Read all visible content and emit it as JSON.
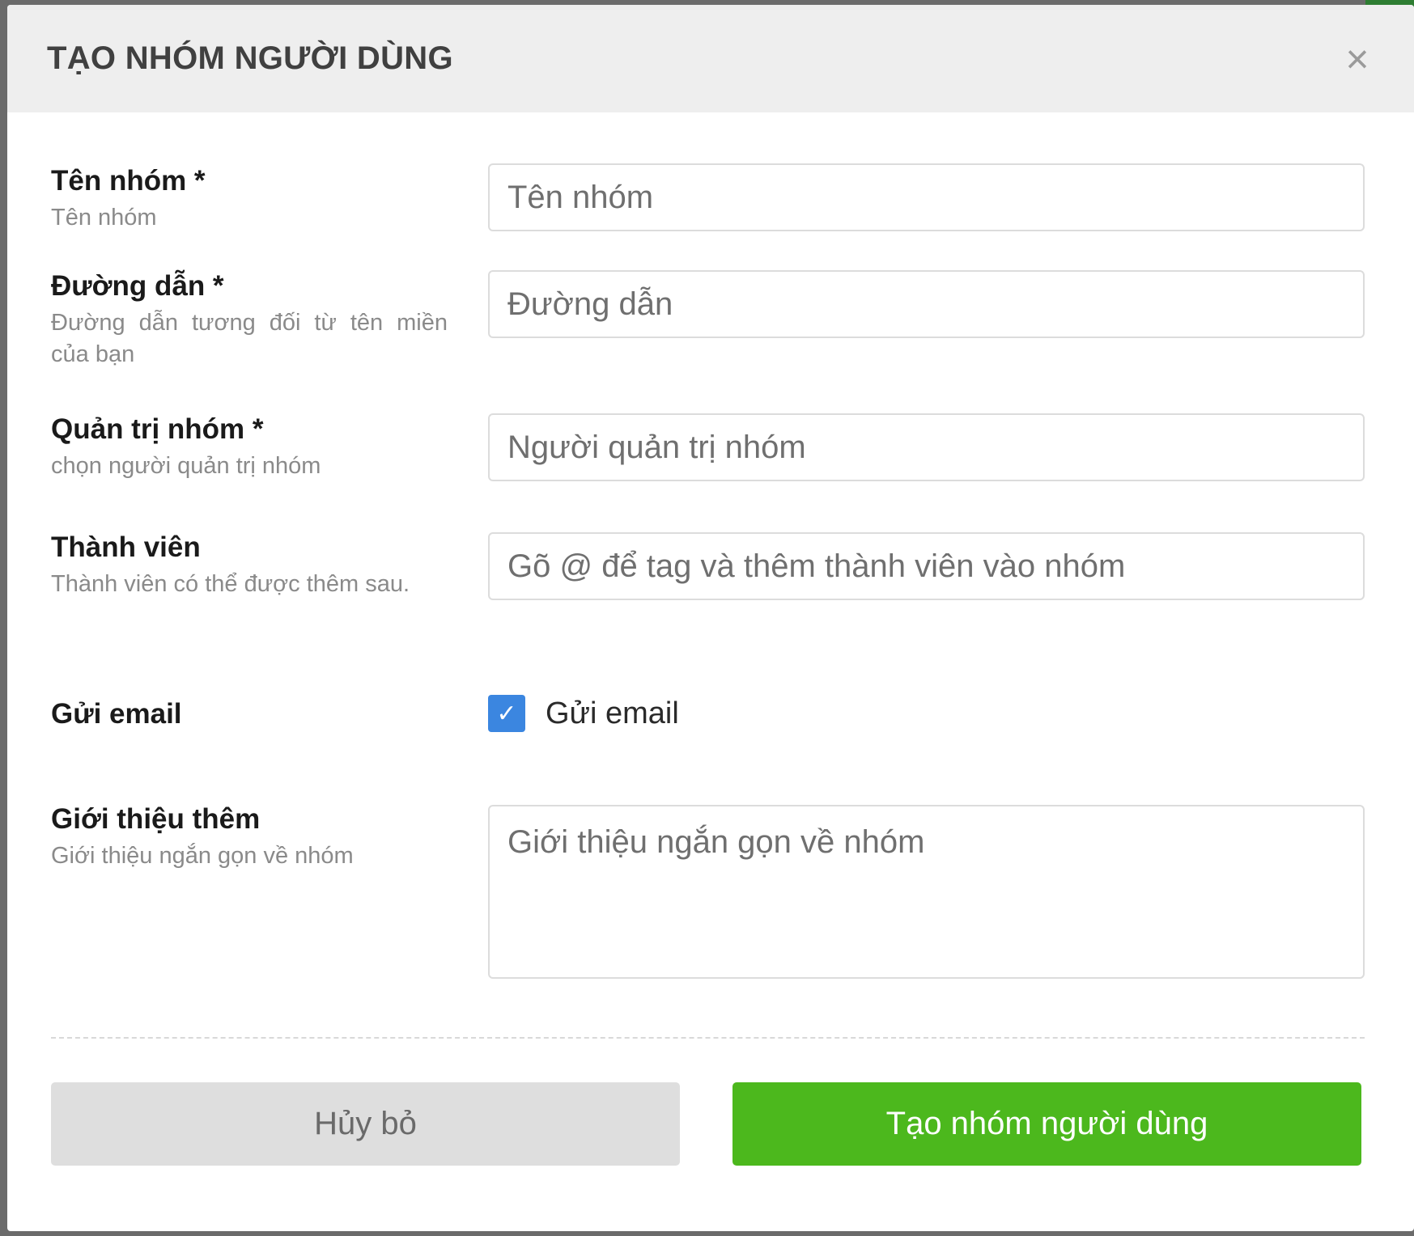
{
  "modal": {
    "title": "TẠO NHÓM NGƯỜI DÙNG",
    "close_icon": "×"
  },
  "fields": {
    "group_name": {
      "label": "Tên nhóm *",
      "help": "Tên nhóm",
      "placeholder": "Tên nhóm"
    },
    "path": {
      "label": "Đường dẫn *",
      "help": "Đường dẫn tương đối từ tên miền của bạn",
      "placeholder": "Đường dẫn"
    },
    "admin": {
      "label": "Quản trị nhóm *",
      "help": "chọn người quản trị nhóm",
      "placeholder": "Người quản trị nhóm"
    },
    "members": {
      "label": "Thành viên",
      "help": "Thành viên có thể được thêm sau.",
      "placeholder": "Gõ @ để tag và thêm thành viên vào nhóm"
    },
    "send_email": {
      "label": "Gửi email",
      "checkbox_label": "Gửi email",
      "checked": true,
      "check_glyph": "✓"
    },
    "intro": {
      "label": "Giới thiệu thêm",
      "help": "Giới thiệu ngắn gọn về nhóm",
      "placeholder": "Giới thiệu ngắn gọn về nhóm"
    }
  },
  "actions": {
    "cancel_label": "Hủy bỏ",
    "create_label": "Tạo nhóm người dùng"
  },
  "colors": {
    "header_bg": "#eeeeee",
    "checkbox": "#3b86e0",
    "create_button": "#4cb81d",
    "cancel_button": "#dedede"
  }
}
